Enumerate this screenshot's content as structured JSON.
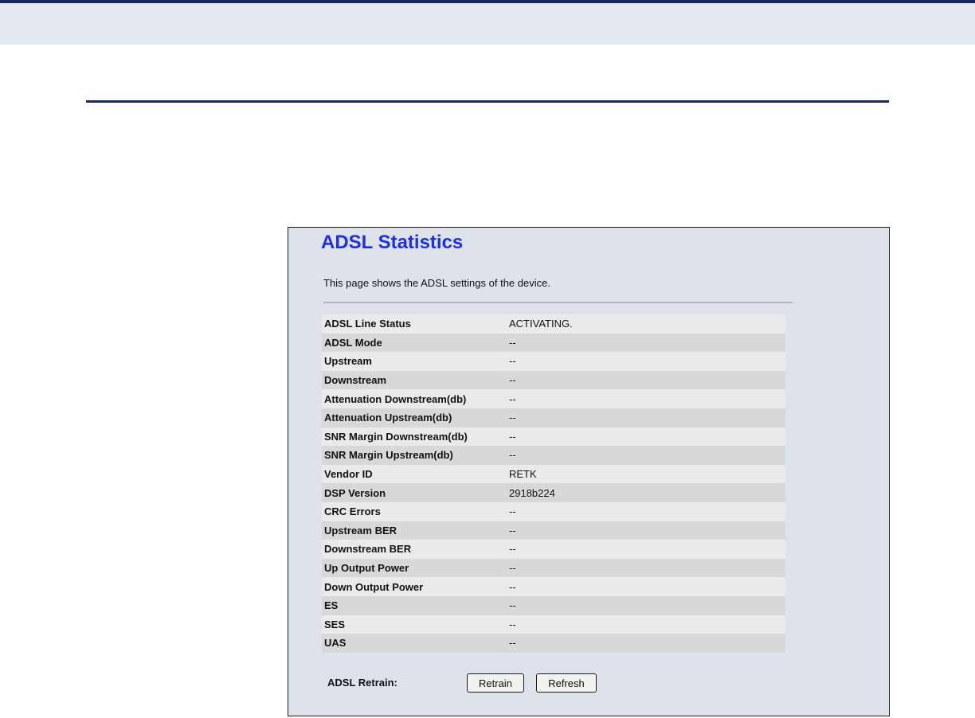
{
  "page": {
    "title": "ADSL Statistics",
    "description": "This page shows the ADSL settings of the device."
  },
  "stats": [
    {
      "label": "ADSL Line Status",
      "value": "ACTIVATING."
    },
    {
      "label": "ADSL Mode",
      "value": "--"
    },
    {
      "label": "Upstream",
      "value": "--"
    },
    {
      "label": "Downstream",
      "value": "--"
    },
    {
      "label": "Attenuation Downstream(db)",
      "value": "--"
    },
    {
      "label": "Attenuation Upstream(db)",
      "value": "--"
    },
    {
      "label": "SNR Margin Downstream(db)",
      "value": "--"
    },
    {
      "label": "SNR Margin Upstream(db)",
      "value": "--"
    },
    {
      "label": "Vendor ID",
      "value": "RETK"
    },
    {
      "label": "DSP Version",
      "value": "2918b224"
    },
    {
      "label": "CRC Errors",
      "value": "--"
    },
    {
      "label": "Upstream BER",
      "value": "--"
    },
    {
      "label": "Downstream BER",
      "value": "--"
    },
    {
      "label": "Up Output Power",
      "value": "--"
    },
    {
      "label": "Down Output Power",
      "value": "--"
    },
    {
      "label": "ES",
      "value": "--"
    },
    {
      "label": "SES",
      "value": "--"
    },
    {
      "label": "UAS",
      "value": "--"
    }
  ],
  "retrain": {
    "label": "ADSL Retrain:",
    "retrain_button": "Retrain",
    "refresh_button": "Refresh"
  },
  "colors": {
    "title": "#1f2ee6",
    "panel_background": "#dde2eb",
    "row_light": "#eaeaea",
    "row_dark": "#d8d8d8",
    "header_rule": "#1a2a5a"
  }
}
